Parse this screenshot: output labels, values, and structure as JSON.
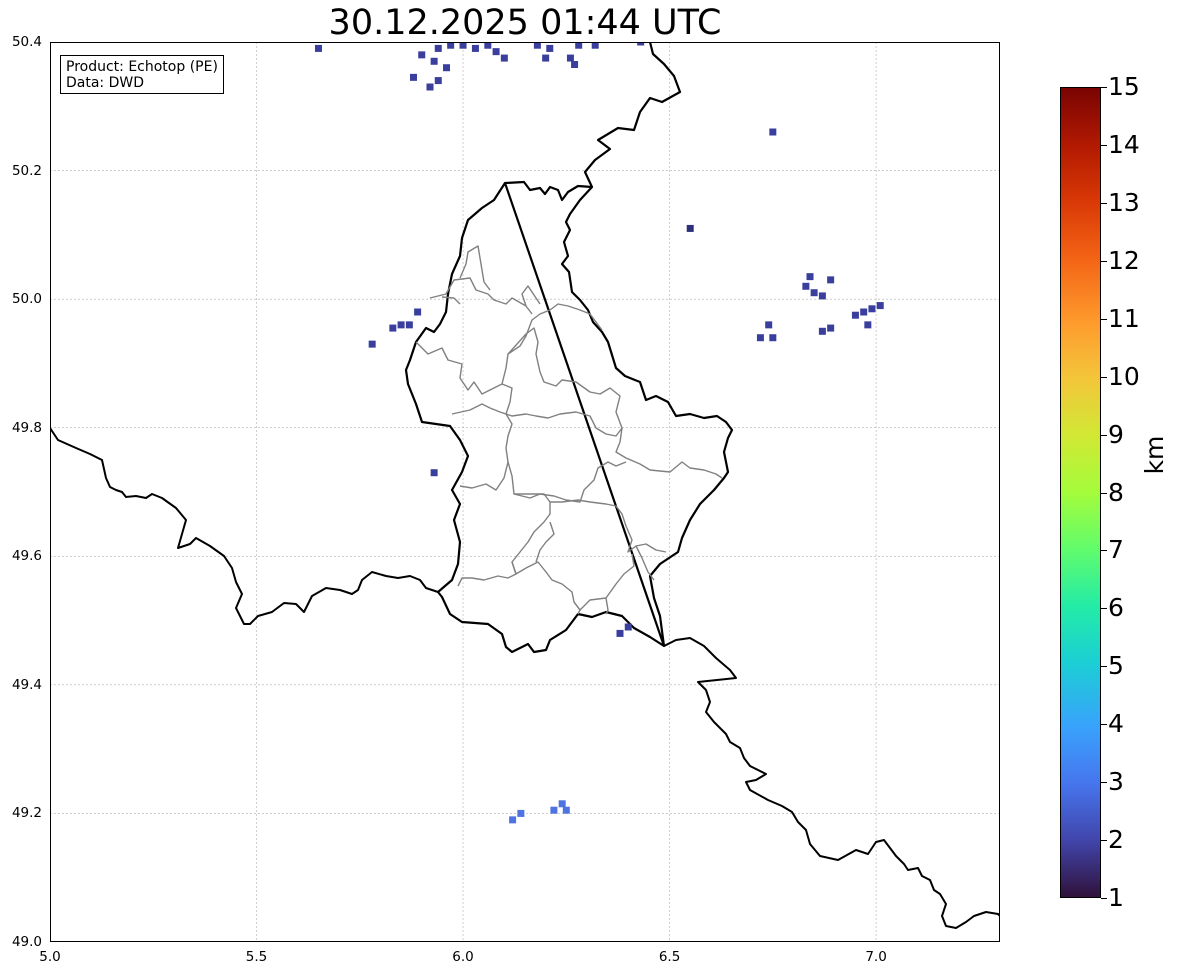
{
  "title": "30.12.2025 01:44 UTC",
  "info_box": {
    "line1": "Product: Echotop (PE)",
    "line2": "Data: DWD"
  },
  "map_extent": {
    "lon": [
      5.0,
      7.3
    ],
    "lat": [
      49.0,
      50.4
    ]
  },
  "lon_ticks": [
    "5.0",
    "5.5",
    "6.0",
    "6.5",
    "7.0"
  ],
  "lat_ticks": [
    "50.4",
    "50.2",
    "50.0",
    "49.8",
    "49.6",
    "49.4",
    "49.2",
    "49.0"
  ],
  "colorbar": {
    "label": "km",
    "ticks": [
      "15",
      "14",
      "13",
      "12",
      "11",
      "10",
      "9",
      "8",
      "7",
      "6",
      "5",
      "4",
      "3",
      "2",
      "1"
    ],
    "min": 1,
    "max": 15,
    "colormap": "turbo"
  },
  "colors": {
    "border": "#000000",
    "admin": "#808080",
    "grid": "#b0b0b0",
    "echo_low": "#2d2f7a",
    "echo_mid": "#3a3f9e",
    "echo_2": "#4a48b8",
    "echo_3": "#4f73e0"
  },
  "chart_data": {
    "type": "heatmap",
    "title": "30.12.2025 01:44 UTC",
    "xlim": [
      5.0,
      7.3
    ],
    "ylim": [
      49.0,
      50.4
    ],
    "value_unit": "km",
    "value_range": [
      1,
      15
    ],
    "grid": true,
    "colorbar": "right",
    "echo_cells": [
      {
        "lon": 5.94,
        "lat": 50.34,
        "value": 2
      },
      {
        "lon": 5.92,
        "lat": 50.33,
        "value": 2
      },
      {
        "lon": 5.96,
        "lat": 50.36,
        "value": 2
      },
      {
        "lon": 5.93,
        "lat": 50.37,
        "value": 2
      },
      {
        "lon": 5.9,
        "lat": 50.38,
        "value": 2
      },
      {
        "lon": 5.94,
        "lat": 50.39,
        "value": 2
      },
      {
        "lon": 5.97,
        "lat": 50.395,
        "value": 2
      },
      {
        "lon": 5.88,
        "lat": 50.345,
        "value": 2
      },
      {
        "lon": 6.0,
        "lat": 50.395,
        "value": 2
      },
      {
        "lon": 6.03,
        "lat": 50.39,
        "value": 2
      },
      {
        "lon": 6.06,
        "lat": 50.395,
        "value": 2
      },
      {
        "lon": 6.08,
        "lat": 50.385,
        "value": 2
      },
      {
        "lon": 6.1,
        "lat": 50.375,
        "value": 2
      },
      {
        "lon": 6.18,
        "lat": 50.395,
        "value": 2
      },
      {
        "lon": 6.21,
        "lat": 50.39,
        "value": 2
      },
      {
        "lon": 6.2,
        "lat": 50.375,
        "value": 2
      },
      {
        "lon": 6.26,
        "lat": 50.375,
        "value": 2
      },
      {
        "lon": 6.28,
        "lat": 50.395,
        "value": 2
      },
      {
        "lon": 6.32,
        "lat": 50.395,
        "value": 2
      },
      {
        "lon": 6.27,
        "lat": 50.365,
        "value": 2
      },
      {
        "lon": 5.65,
        "lat": 50.39,
        "value": 2
      },
      {
        "lon": 6.43,
        "lat": 50.4,
        "value": 2
      },
      {
        "lon": 6.75,
        "lat": 50.26,
        "value": 2
      },
      {
        "lon": 6.55,
        "lat": 50.11,
        "value": 1
      },
      {
        "lon": 6.83,
        "lat": 50.02,
        "value": 2
      },
      {
        "lon": 6.85,
        "lat": 50.01,
        "value": 2
      },
      {
        "lon": 6.87,
        "lat": 50.005,
        "value": 2
      },
      {
        "lon": 6.89,
        "lat": 50.03,
        "value": 2
      },
      {
        "lon": 6.84,
        "lat": 50.035,
        "value": 2
      },
      {
        "lon": 6.97,
        "lat": 49.98,
        "value": 2
      },
      {
        "lon": 6.99,
        "lat": 49.985,
        "value": 2
      },
      {
        "lon": 6.95,
        "lat": 49.975,
        "value": 2
      },
      {
        "lon": 6.98,
        "lat": 49.96,
        "value": 2
      },
      {
        "lon": 7.01,
        "lat": 49.99,
        "value": 2
      },
      {
        "lon": 6.74,
        "lat": 49.96,
        "value": 2
      },
      {
        "lon": 6.75,
        "lat": 49.94,
        "value": 2
      },
      {
        "lon": 6.72,
        "lat": 49.94,
        "value": 2
      },
      {
        "lon": 6.87,
        "lat": 49.95,
        "value": 2
      },
      {
        "lon": 6.89,
        "lat": 49.955,
        "value": 2
      },
      {
        "lon": 5.85,
        "lat": 49.96,
        "value": 2
      },
      {
        "lon": 5.83,
        "lat": 49.955,
        "value": 2
      },
      {
        "lon": 5.87,
        "lat": 49.96,
        "value": 2
      },
      {
        "lon": 5.89,
        "lat": 49.98,
        "value": 2
      },
      {
        "lon": 5.78,
        "lat": 49.93,
        "value": 2
      },
      {
        "lon": 5.93,
        "lat": 49.73,
        "value": 2
      },
      {
        "lon": 6.38,
        "lat": 49.48,
        "value": 2
      },
      {
        "lon": 6.4,
        "lat": 49.49,
        "value": 2
      },
      {
        "lon": 6.12,
        "lat": 49.19,
        "value": 3
      },
      {
        "lon": 6.14,
        "lat": 49.2,
        "value": 3
      },
      {
        "lon": 6.22,
        "lat": 49.205,
        "value": 3
      },
      {
        "lon": 6.24,
        "lat": 49.215,
        "value": 3
      },
      {
        "lon": 6.25,
        "lat": 49.205,
        "value": 3
      }
    ]
  }
}
